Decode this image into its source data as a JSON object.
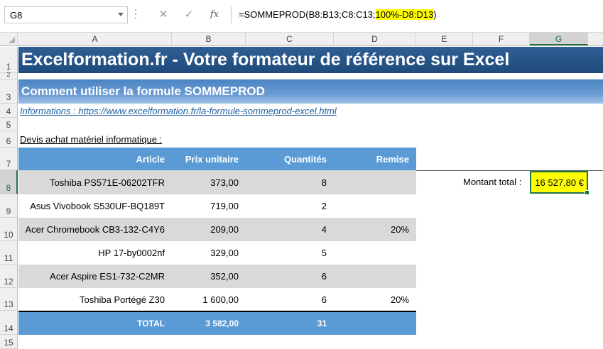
{
  "formula_bar": {
    "name_box": "G8",
    "cancel_icon": "✕",
    "enter_icon": "✓",
    "fx_label": "fx",
    "formula_plain": "=SOMMEPROD(B8:B13;C8:C13;",
    "formula_highlight": "100%-D8:D13",
    "formula_end": ")"
  },
  "columns": [
    "A",
    "B",
    "C",
    "D",
    "E",
    "F",
    "G"
  ],
  "rows": [
    "1",
    "2",
    "3",
    "4",
    "5",
    "6",
    "7",
    "8",
    "9",
    "10",
    "11",
    "12",
    "13",
    "14",
    "15"
  ],
  "banner_title": "Excelformation.fr - Votre formateur de référence sur Excel",
  "subtitle": "Comment utiliser la formule SOMMEPROD",
  "info_link": "Informations : https://www.excelformation.fr/la-formule-sommeprod-excel.html",
  "devis_label": "Devis achat matériel informatique :",
  "table": {
    "headers": [
      "Article",
      "Prix unitaire",
      "Quantités",
      "Remise"
    ],
    "rows": [
      {
        "article": "Toshiba PS571E-06202TFR",
        "prix": "373,00",
        "qte": "8",
        "remise": ""
      },
      {
        "article": "Asus Vivobook S530UF-BQ189T",
        "prix": "719,00",
        "qte": "2",
        "remise": ""
      },
      {
        "article": "Acer Chromebook CB3-132-C4Y6",
        "prix": "209,00",
        "qte": "4",
        "remise": "20%"
      },
      {
        "article": "HP 17-by0002nf",
        "prix": "329,00",
        "qte": "5",
        "remise": ""
      },
      {
        "article": "Acer Aspire ES1-732-C2MR",
        "prix": "352,00",
        "qte": "6",
        "remise": ""
      },
      {
        "article": "Toshiba Portégé Z30",
        "prix": "1 600,00",
        "qte": "6",
        "remise": "20%"
      }
    ],
    "total": {
      "label": "TOTAL",
      "prix": "3 582,00",
      "qte": "31"
    }
  },
  "montant": {
    "label": "Montant total :",
    "value": "16 527,80 €"
  },
  "colors": {
    "header_blue": "#5b9bd5",
    "banner_blue": "#204a7b",
    "highlight": "#ffff00",
    "excel_green": "#217346"
  }
}
